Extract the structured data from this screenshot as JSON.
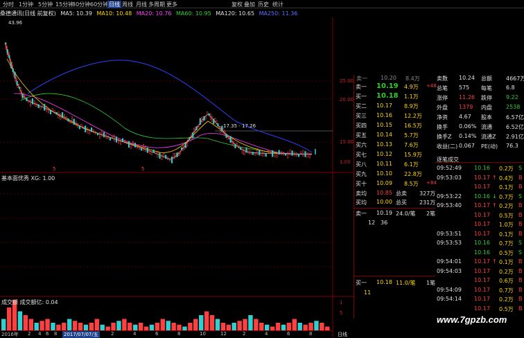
{
  "toolbar": {
    "periods": [
      "分时",
      "1分钟",
      "5分钟",
      "15分钟",
      "30分钟",
      "60分钟",
      "日线",
      "周线",
      "月线",
      "多周期",
      "更多"
    ],
    "active_period": "日线",
    "right_items": [
      "复权",
      "叠加",
      "历史",
      "统计"
    ]
  },
  "ma_bar": {
    "title": "桑德通讯(日线 前复权)",
    "ma5": "MA5: 10.39",
    "ma10": "MA10: 10.48",
    "ma20": "MA20: 10.76",
    "ma60": "MA60: 10.95",
    "ma120": "MA120: 10.65",
    "ma250": "MA250: 11.36"
  },
  "chart": {
    "high_label": "43.96",
    "range_label": "17.35 - 17.26",
    "price_ticks": [
      "25.00",
      "20.00",
      "15.00",
      "1.00"
    ],
    "indicator_title": "基本面优秀 XG: 1.00",
    "volume_title": "成交额 成交额亿: 0.04",
    "vol_ticks": [
      "1",
      "5"
    ],
    "markers": [
      "5",
      "5"
    ],
    "date_labels": [
      "2016年",
      "2",
      "4",
      "6",
      "8",
      "10",
      "12",
      "2017/07/07/五",
      "2",
      "4",
      "6",
      "8",
      "10",
      "12",
      "2",
      "4",
      "6",
      "8"
    ],
    "period_label": "日线",
    "colors": {
      "up": "#ff4040",
      "down": "#30d0d0",
      "ma5": "#e0e0e0",
      "ma10": "#ffd700",
      "ma20": "#ff40ff",
      "ma60": "#30d030",
      "ma250": "#3040ff"
    },
    "volume_values": [
      0.3,
      0.6,
      0.8,
      0.5,
      0.4,
      0.3,
      0.2,
      0.25,
      0.3,
      0.2,
      0.15,
      0.2,
      0.3,
      0.25,
      0.2,
      0.15,
      0.2,
      0.3,
      0.15,
      0.1,
      0.2,
      0.25,
      0.3,
      0.2,
      0.15,
      0.2,
      0.1,
      0.15,
      0.2,
      0.3,
      0.25,
      0.2,
      0.15,
      0.1,
      0.2,
      0.3,
      0.4,
      0.5,
      0.4,
      0.3,
      0.2,
      0.15,
      0.2,
      0.25,
      0.3,
      0.4,
      0.3,
      0.2,
      0.15,
      0.1,
      0.2,
      0.15,
      0.2,
      0.3,
      0.2,
      0.15,
      0.2,
      0.25,
      0.2,
      0.1
    ]
  },
  "quote": {
    "top_row": {
      "label": "卖一",
      "price": "10.20",
      "vol": "8.4万"
    },
    "asks": [
      {
        "label": "卖一",
        "price": "10.19",
        "vol": "4.9万",
        "delta": "+48"
      },
      {
        "label": "买一",
        "price": "10.18",
        "vol": "1.1万"
      },
      {
        "label": "买二",
        "price": "10.17",
        "vol": "8.9万"
      },
      {
        "label": "买三",
        "price": "10.16",
        "vol": "12.2万"
      },
      {
        "label": "买四",
        "price": "10.15",
        "vol": "16.5万"
      },
      {
        "label": "买五",
        "price": "10.14",
        "vol": "5.7万"
      },
      {
        "label": "买六",
        "price": "10.13",
        "vol": "7.6万"
      },
      {
        "label": "买七",
        "price": "10.12",
        "vol": "15.9万"
      },
      {
        "label": "买八",
        "price": "10.11",
        "vol": "6.1万"
      },
      {
        "label": "买九",
        "price": "10.10",
        "vol": "22.8万"
      },
      {
        "label": "买十",
        "price": "10.09",
        "vol": "8.5万",
        "delta": "+84"
      }
    ],
    "avg_sell": {
      "label": "卖均",
      "price": "10.85",
      "tlabel": "总卖",
      "val": "327万"
    },
    "avg_buy": {
      "label": "买均",
      "price": "10.00",
      "tlabel": "总买",
      "val": "231万"
    },
    "sell1": {
      "label": "卖一",
      "price": "10.19",
      "vol": "24.0/笔",
      "count": "2笔"
    },
    "sell1_detail": [
      "12",
      "36"
    ],
    "buy1": {
      "label": "买一",
      "price": "10.18",
      "vol": "11.0/笔",
      "count": "1笔"
    },
    "buy1_detail": [
      "11"
    ]
  },
  "stats": {
    "rows": [
      {
        "l1": "卖数",
        "v1": "10.24",
        "l2": "总额",
        "v2": "4667万"
      },
      {
        "l1": "总笔",
        "v1": "575",
        "l2": "每笔",
        "v2": "6.8"
      },
      {
        "l1": "涨停",
        "v1": "11.26",
        "l2": "跌停",
        "v2": "9.22"
      },
      {
        "l1": "外盘",
        "v1": "1379",
        "l2": "内盘",
        "v2": "2538"
      },
      {
        "l1": "净资",
        "v1": "4.67",
        "l2": "股本",
        "v2": "6.57亿"
      },
      {
        "l1": "换手",
        "v1": "0.06%",
        "l2": "流通",
        "v2": "6.52亿"
      },
      {
        "l1": "换手Z",
        "v1": "0.14%",
        "l2": "流通Z",
        "v2": "2.91亿"
      },
      {
        "l1": "收益(二)",
        "v1": "0.067",
        "l2": "PE(动)",
        "v2": "76.3"
      }
    ]
  },
  "trades": {
    "title": "逐笔成交",
    "rows": [
      {
        "t": "09:52:49",
        "p": "10.16",
        "d": "",
        "v": "0.2万",
        "s": "S"
      },
      {
        "t": "09:53:03",
        "p": "10.17",
        "d": "↑",
        "v": "0.4万",
        "s": "B"
      },
      {
        "t": "",
        "p": "10.17",
        "d": "",
        "v": "0.1万",
        "s": "B"
      },
      {
        "t": "09:53:22",
        "p": "10.16",
        "d": "↓",
        "v": "0.7万",
        "s": "S"
      },
      {
        "t": "09:53:40",
        "p": "10.17",
        "d": "↑",
        "v": "0.2万",
        "s": "B"
      },
      {
        "t": "",
        "p": "10.17",
        "d": "",
        "v": "0.5万",
        "s": "B"
      },
      {
        "t": "",
        "p": "10.17",
        "d": "",
        "v": "1.0万",
        "s": "B"
      },
      {
        "t": "09:53:51",
        "p": "10.17",
        "d": "",
        "v": "0.1万",
        "s": "B"
      },
      {
        "t": "09:53:53",
        "p": "10.16",
        "d": "",
        "v": "0.7万",
        "s": "S"
      },
      {
        "t": "",
        "p": "10.16",
        "d": "",
        "v": "0.5万",
        "s": "S"
      },
      {
        "t": "09:54:01",
        "p": "10.17",
        "d": "↑",
        "v": "0.1万",
        "s": "B"
      },
      {
        "t": "09:54:03",
        "p": "10.17",
        "d": "",
        "v": "0.2万",
        "s": "B"
      },
      {
        "t": "",
        "p": "10.17",
        "d": "",
        "v": "0.6万",
        "s": "B"
      },
      {
        "t": "09:54:09",
        "p": "10.17",
        "d": "",
        "v": "0.7万",
        "s": "B"
      },
      {
        "t": "09:54:14",
        "p": "10.17",
        "d": "",
        "v": "0.2万",
        "s": "B"
      },
      {
        "t": "",
        "p": "10.17",
        "d": "",
        "v": "0.5万",
        "s": "B"
      }
    ]
  },
  "watermark": "www.7gpzb.com"
}
